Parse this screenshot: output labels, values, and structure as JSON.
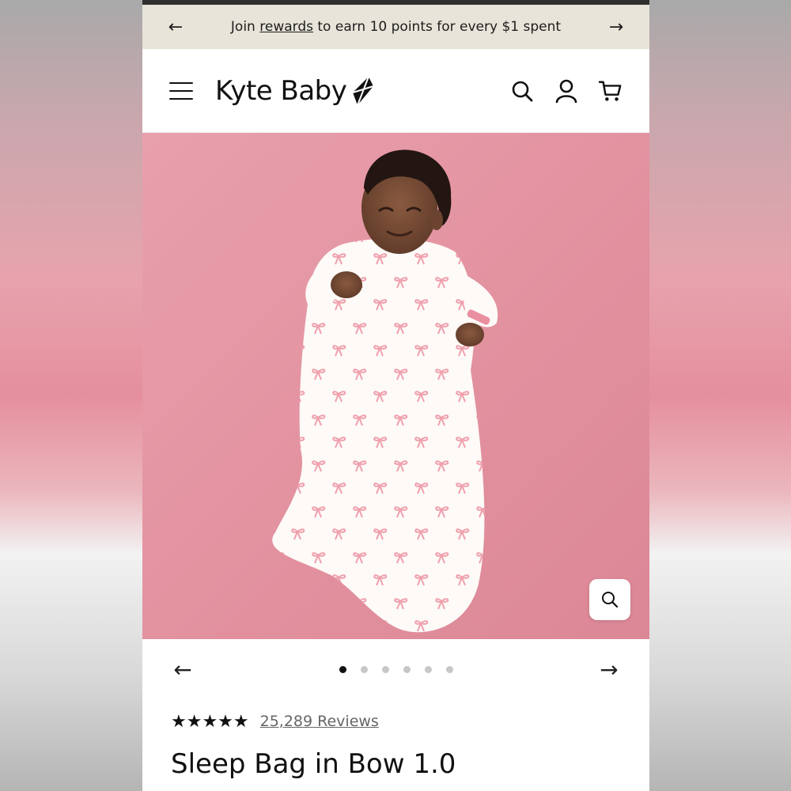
{
  "promo": {
    "prefix": "Join ",
    "link": "rewards",
    "suffix": " to earn 10 points for every $1 spent",
    "prev_icon": "arrow-left-icon",
    "next_icon": "arrow-right-icon"
  },
  "header": {
    "brand": "Kyte Baby",
    "icons": [
      "menu-icon",
      "search-icon",
      "account-icon",
      "cart-icon"
    ]
  },
  "carousel": {
    "slide_count": 6,
    "active_index": 0
  },
  "product": {
    "stars": "★★★★★",
    "rating": 5,
    "reviews": "25,289 Reviews",
    "title": "Sleep Bag in Bow 1.0"
  },
  "colors": {
    "promo_bg": "#e8e4d9",
    "hero_bg": "#e497a3",
    "accent_pink": "#e8899a"
  }
}
